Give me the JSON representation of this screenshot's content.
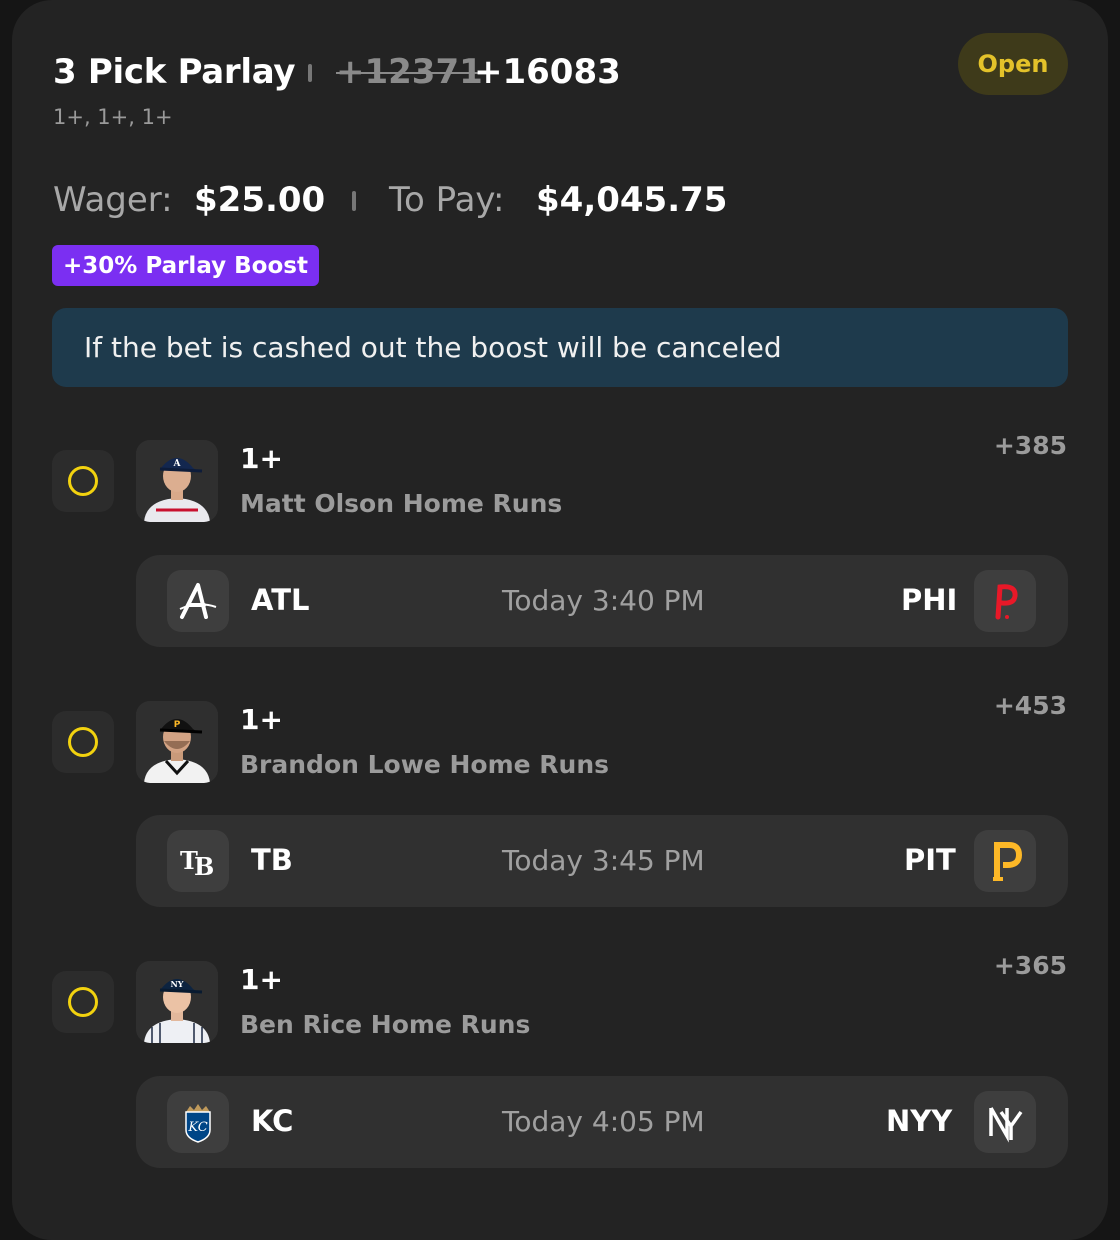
{
  "header": {
    "title": "3 Pick Parlay",
    "original_odds": "+12371",
    "boosted_odds": "+16083",
    "legs_summary": "1+, 1+, 1+",
    "status": "Open"
  },
  "bet": {
    "wager_label": "Wager:",
    "wager": "$25.00",
    "to_pay_label": "To Pay:",
    "to_pay": "$4,045.75",
    "boost_badge": "+30% Parlay Boost",
    "notice": "If the bet is cashed out the boost will be canceled"
  },
  "picks": [
    {
      "line": "1+",
      "description": "Matt Olson Home Runs",
      "odds": "+385",
      "away_team": "ATL",
      "home_team": "PHI",
      "time": "Today 3:40 PM",
      "away_logo": "braves-logo-icon",
      "home_logo": "phillies-logo-icon"
    },
    {
      "line": "1+",
      "description": "Brandon Lowe Home Runs",
      "odds": "+453",
      "away_team": "TB",
      "home_team": "PIT",
      "time": "Today 3:45 PM",
      "away_logo": "rays-logo-icon",
      "home_logo": "pirates-logo-icon"
    },
    {
      "line": "1+",
      "description": "Ben Rice Home Runs",
      "odds": "+365",
      "away_team": "KC",
      "home_team": "NYY",
      "time": "Today 4:05 PM",
      "away_logo": "royals-logo-icon",
      "home_logo": "yankees-logo-icon"
    }
  ],
  "colors": {
    "background": "#232323",
    "status_ring": "#f2d20f",
    "status_pill_text": "#e3c22a",
    "boost_purple": "#7b2ff2",
    "notice_bg": "#1e3a4c"
  }
}
